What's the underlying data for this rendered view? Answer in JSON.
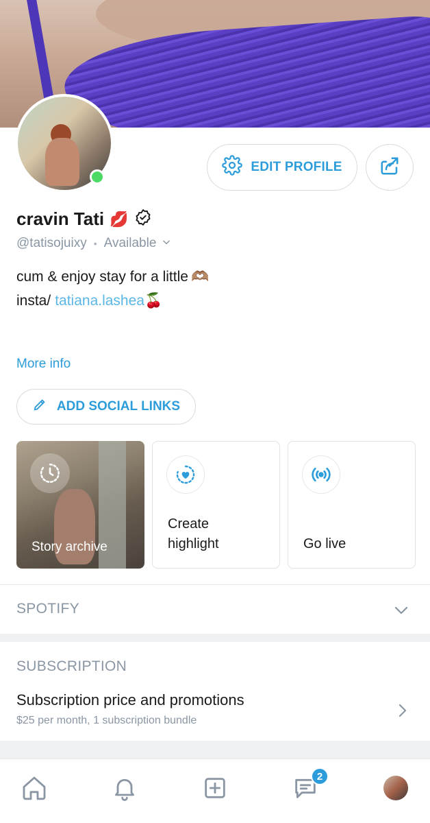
{
  "profile": {
    "display_name": "cravin Tati",
    "name_emoji": "💋",
    "handle": "@tatisojuixy",
    "status": "Available",
    "status_color": "#4cd964"
  },
  "buttons": {
    "edit_profile": "EDIT PROFILE",
    "add_social_links": "ADD SOCIAL LINKS"
  },
  "bio": {
    "line1_text": "cum & enjoy stay for a little",
    "line1_emoji": "🫶🏽",
    "line2_prefix": "insta/",
    "line2_link": "tatiana.lashea",
    "line2_emoji": "🍒"
  },
  "more_info": "More info",
  "cards": {
    "story_archive": "Story archive",
    "create_highlight_line1": "Create",
    "create_highlight_line2": "highlight",
    "go_live": "Go live"
  },
  "sections": {
    "spotify_title": "SPOTIFY",
    "subscription_title": "SUBSCRIPTION",
    "subscription_item_title": "Subscription price and promotions",
    "subscription_item_meta": "$25 per month, 1 subscription bundle"
  },
  "nav": {
    "messages_badge": "2"
  },
  "icons": {
    "edit": "gear-icon",
    "share": "share-icon",
    "verified": "verified-badge-icon",
    "chevron": "chevron-down-icon",
    "pencil": "pencil-icon",
    "archive": "clock-history-icon",
    "highlight": "heart-highlight-icon",
    "live": "broadcast-icon",
    "home": "home-icon",
    "notifications": "bell-icon",
    "create": "plus-square-icon",
    "messages": "chat-icon"
  },
  "colors": {
    "accent": "#2d9cdb",
    "muted": "#8a96a3",
    "link": "#5bb6e6"
  }
}
